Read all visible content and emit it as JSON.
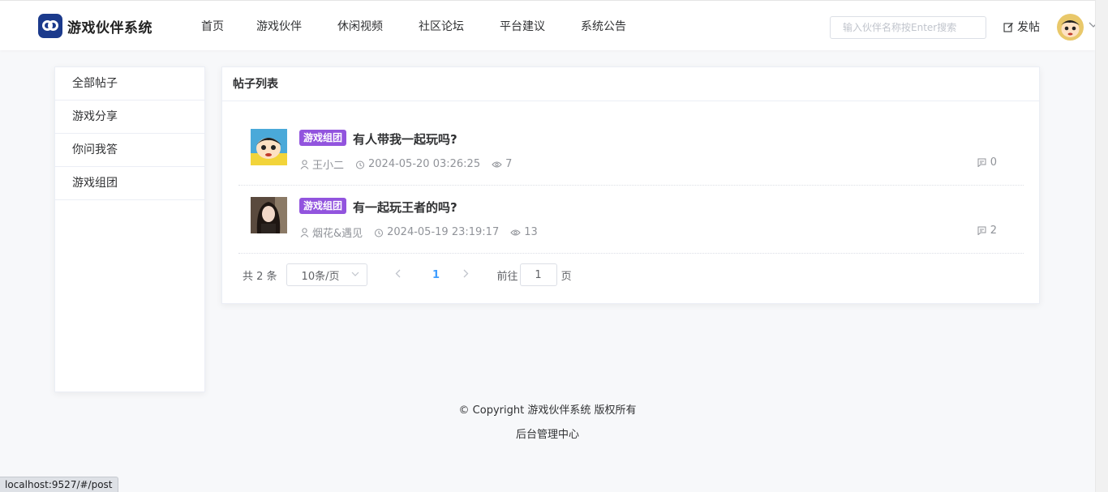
{
  "header": {
    "logo_text": "游戏伙伴系统",
    "nav": [
      "首页",
      "游戏伙伴",
      "休闲视频",
      "社区论坛",
      "平台建议",
      "系统公告"
    ],
    "search_placeholder": "输入伙伴名称按Enter搜索",
    "post_label": "发帖"
  },
  "sidebar": {
    "items": [
      "全部帖子",
      "游戏分享",
      "你问我答",
      "游戏组团"
    ]
  },
  "main": {
    "title": "帖子列表",
    "posts": [
      {
        "tag": "游戏组团",
        "title": "有人带我一起玩吗?",
        "author": "王小二",
        "time": "2024-05-20 03:26:25",
        "views": "7",
        "comments": "0"
      },
      {
        "tag": "游戏组团",
        "title": "有一起玩王者的吗?",
        "author": "烟花&遇见",
        "time": "2024-05-19 23:19:17",
        "views": "13",
        "comments": "2"
      }
    ],
    "pagination": {
      "total": "共 2 条",
      "page_size": "10条/页",
      "current_page": "1",
      "goto_label": "前往",
      "goto_value": "1",
      "page_suffix": "页"
    }
  },
  "footer": {
    "copyright": "© Copyright 游戏伙伴系统 版权所有",
    "admin_link": "后台管理中心"
  },
  "status_url": "localhost:9527/#/post",
  "colors": {
    "tag": "#9254de",
    "accent": "#409eff",
    "logo": "#1b3a8c"
  }
}
